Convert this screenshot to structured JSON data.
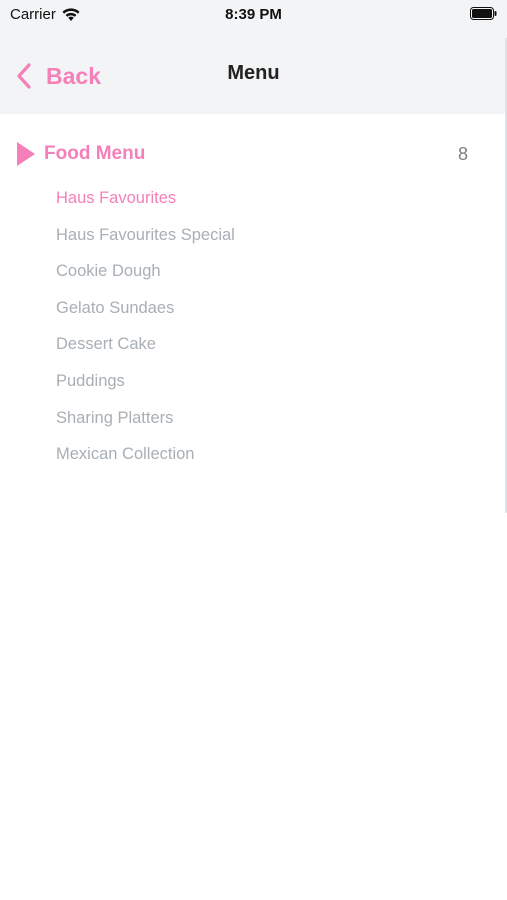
{
  "status_bar": {
    "carrier": "Carrier",
    "time": "8:39 PM"
  },
  "nav": {
    "back_label": "Back",
    "title": "Menu"
  },
  "section": {
    "title": "Food Menu",
    "count": "8",
    "items": [
      "Haus Favourites",
      "Haus Favourites Special",
      "Cookie Dough",
      "Gelato Sundaes",
      "Dessert Cake",
      "Puddings",
      "Sharing Platters",
      "Mexican Collection"
    ],
    "selected_index": 0
  },
  "colors": {
    "accent": "#f57fb9",
    "nav_background": "#f3f4f6",
    "item_text": "#a8afb5",
    "count_text": "#7f7f7f"
  },
  "icons": [
    "wifi-icon",
    "battery-icon",
    "chevron-left-icon",
    "play-icon"
  ]
}
